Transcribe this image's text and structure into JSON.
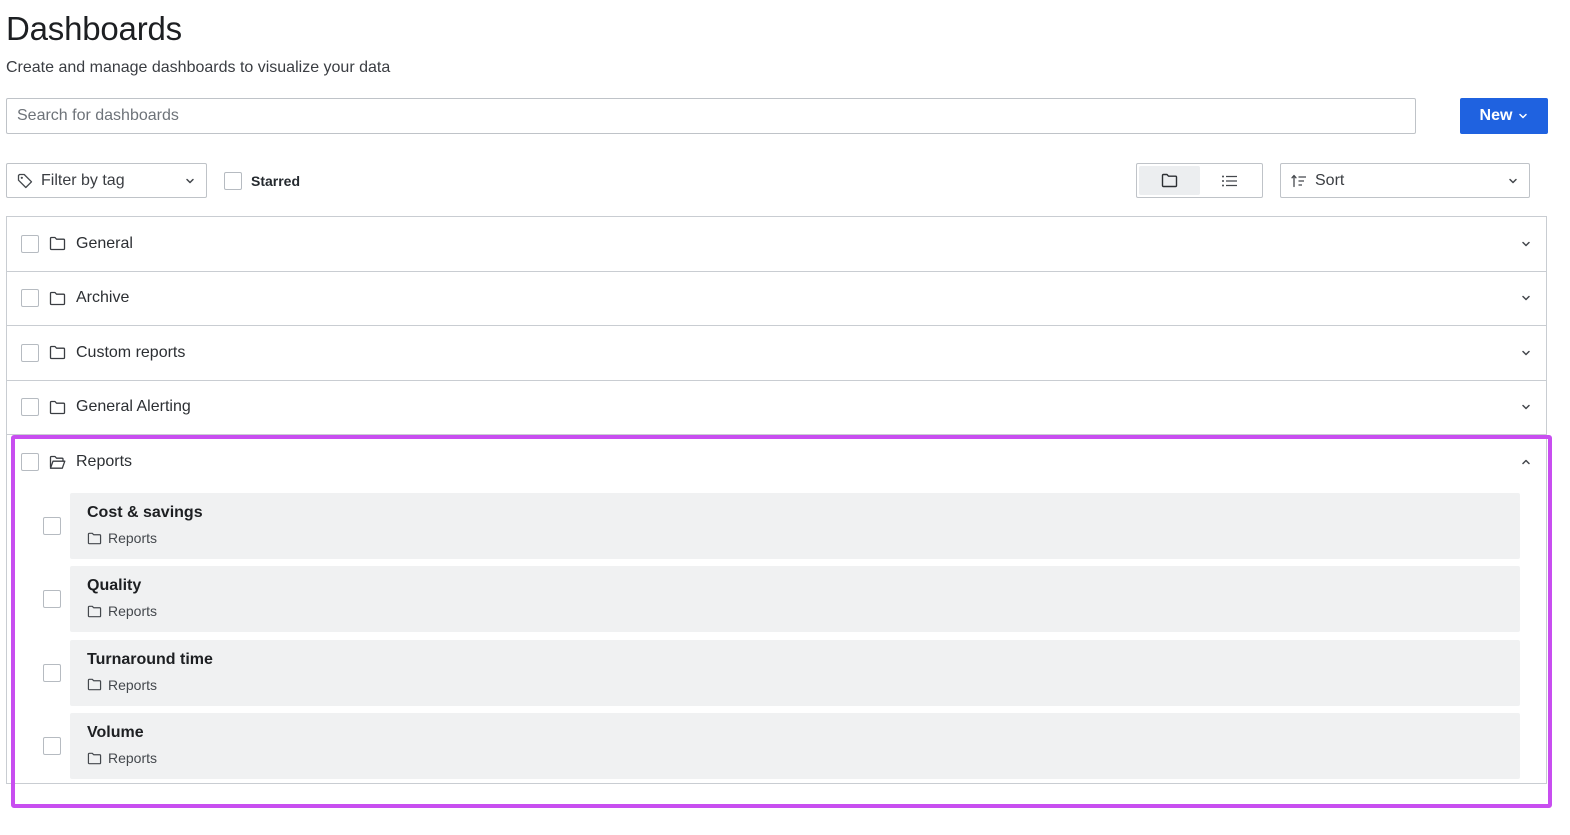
{
  "header": {
    "title": "Dashboards",
    "subtitle": "Create and manage dashboards to visualize your data"
  },
  "search": {
    "placeholder": "Search for dashboards",
    "value": ""
  },
  "new_button": {
    "label": "New"
  },
  "filters": {
    "tag_filter_label": "Filter by tag",
    "starred_label": "Starred",
    "starred_checked": false,
    "sort_label": "Sort",
    "view_mode": "folders"
  },
  "folders": [
    {
      "name": "General",
      "expanded": false
    },
    {
      "name": "Archive",
      "expanded": false
    },
    {
      "name": "Custom reports",
      "expanded": false
    },
    {
      "name": "General Alerting",
      "expanded": false
    },
    {
      "name": "Reports",
      "expanded": true,
      "dashboards": [
        {
          "title": "Cost & savings",
          "folder": "Reports"
        },
        {
          "title": "Quality",
          "folder": "Reports"
        },
        {
          "title": "Turnaround time",
          "folder": "Reports"
        },
        {
          "title": "Volume",
          "folder": "Reports"
        }
      ]
    }
  ],
  "colors": {
    "primary_button": "#1f62e0",
    "highlight": "#c84ef0",
    "card_background": "#f0f1f2"
  }
}
